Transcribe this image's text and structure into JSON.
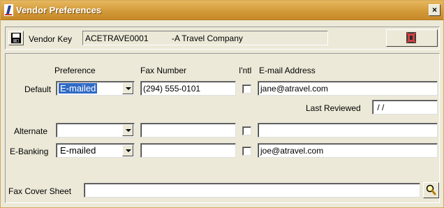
{
  "window": {
    "title": "Vendor Preferences",
    "close_label": "×"
  },
  "vendor_key": {
    "label": "Vendor Key",
    "value": "ACETRAVE0001          -A Travel Company"
  },
  "headers": {
    "preference": "Preference",
    "fax_number": "Fax Number",
    "intl": "I'ntl",
    "email": "E-mail Address"
  },
  "rows": {
    "default": {
      "label": "Default",
      "preference": "E-mailed",
      "fax": "(294) 555-0101",
      "intl": false,
      "email": "jane@atravel.com"
    },
    "alternate": {
      "label": "Alternate",
      "preference": "",
      "fax": "",
      "intl": false,
      "email": ""
    },
    "ebanking": {
      "label": "E-Banking",
      "preference": "E-mailed",
      "fax": "",
      "intl": false,
      "email": "joe@atravel.com"
    }
  },
  "last_reviewed": {
    "label": "Last Reviewed",
    "value": " / /"
  },
  "fax_cover": {
    "label": "Fax Cover Sheet",
    "value": ""
  },
  "icons": {
    "app": "app-logo-icon",
    "save": "floppy-disk-icon",
    "exit": "exit-door-icon",
    "search": "magnifier-icon"
  },
  "colors": {
    "titlebar": "#d39a3a",
    "highlight": "#316ac5",
    "window_bg": "#ece9d8"
  }
}
